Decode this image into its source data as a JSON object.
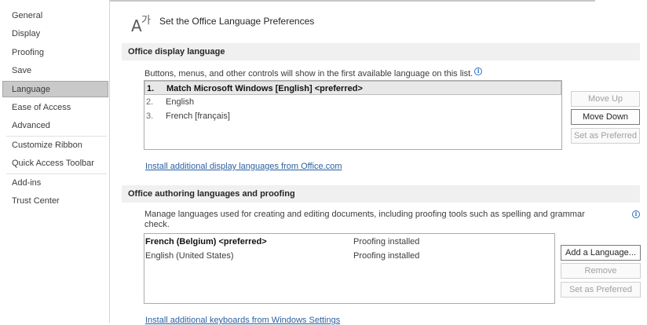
{
  "sidebar": {
    "items": [
      {
        "label": "General"
      },
      {
        "label": "Display"
      },
      {
        "label": "Proofing"
      },
      {
        "label": "Save"
      },
      {
        "label": "Language",
        "selected": true
      },
      {
        "label": "Ease of Access"
      },
      {
        "label": "Advanced"
      },
      {
        "label": "Customize Ribbon"
      },
      {
        "label": "Quick Access Toolbar"
      },
      {
        "label": "Add-ins"
      },
      {
        "label": "Trust Center"
      }
    ]
  },
  "header": {
    "icon": "language-icon",
    "title": "Set the Office Language Preferences"
  },
  "display_language": {
    "section_title": "Office display language",
    "description": "Buttons, menus, and other controls will show in the first available language on this list.",
    "languages": [
      {
        "num": "1.",
        "label": "Match Microsoft Windows [English] <preferred>",
        "selected": true
      },
      {
        "num": "2.",
        "label": "English"
      },
      {
        "num": "3.",
        "label": "French [français]"
      }
    ],
    "buttons": {
      "move_up": "Move Up",
      "move_down": "Move Down",
      "set_preferred": "Set as Preferred"
    },
    "link": "Install additional display languages from Office.com"
  },
  "authoring": {
    "section_title": "Office authoring languages and proofing",
    "description_line1": "Manage languages used for creating and editing documents, including proofing tools such as spelling and grammar",
    "description_line2": "check.",
    "languages": [
      {
        "label": "French (Belgium) <preferred>",
        "status": "Proofing installed",
        "bold": true
      },
      {
        "label": "English (United States)",
        "status": "Proofing installed"
      }
    ],
    "buttons": {
      "add": "Add a Language...",
      "remove": "Remove",
      "set_preferred": "Set as Preferred"
    },
    "link": "Install additional keyboards from Windows Settings"
  },
  "colors": {
    "link": "#2c5f9e",
    "selected_nav": "#c9c9c9",
    "section_bar": "#f0f0f0"
  }
}
